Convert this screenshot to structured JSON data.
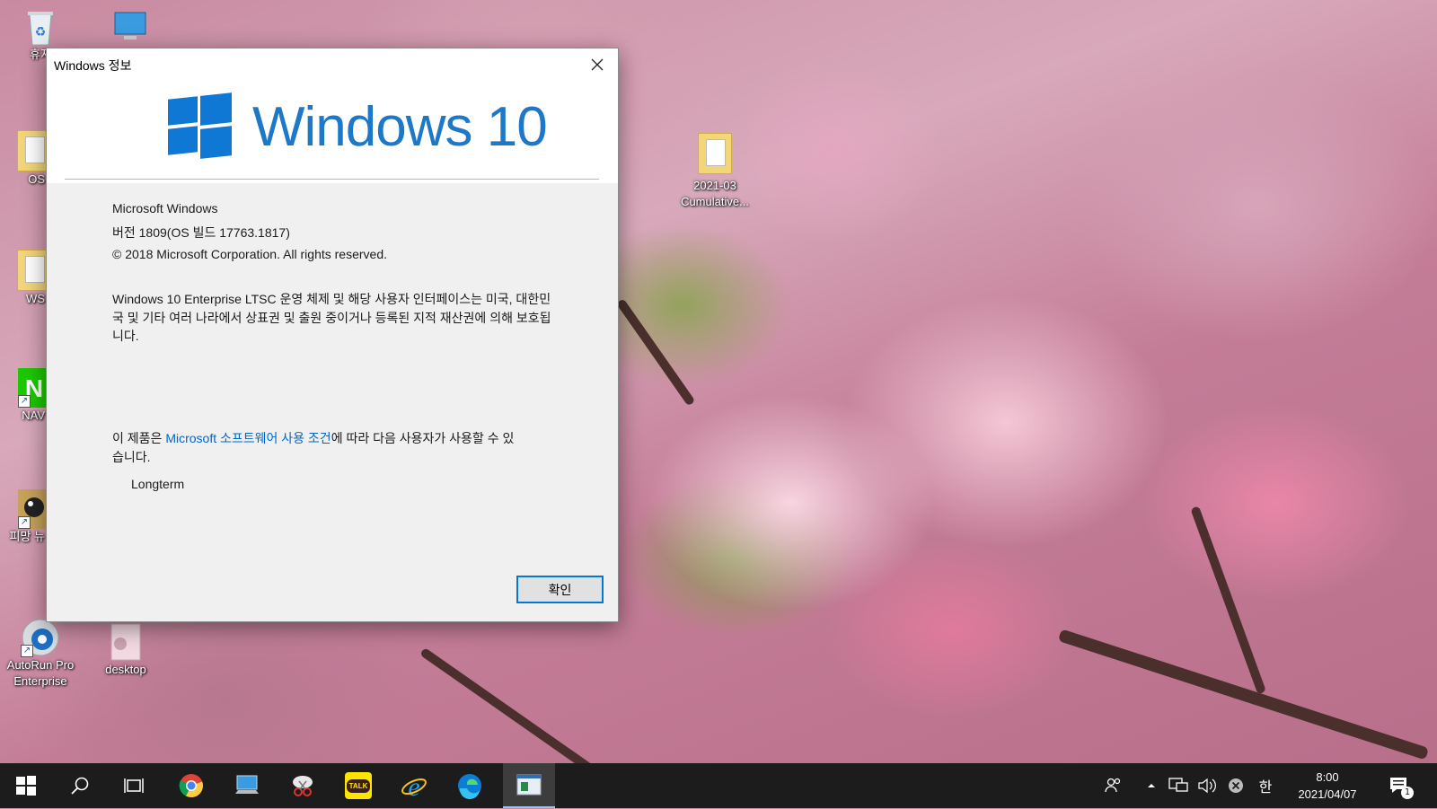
{
  "dialog": {
    "title": "Windows 정보",
    "wordmark": "Windows 10",
    "product": "Microsoft Windows",
    "version": "버전 1809(OS 빌드 17763.1817)",
    "copyright": "© 2018 Microsoft Corporation. All rights reserved.",
    "legal_text": "Windows 10 Enterprise LTSC 운영 체제 및 해당 사용자 인터페이스는 미국, 대한민국 및 기타 여러 나라에서 상표권 및 출원 중이거나 등록된 지적 재산권에 의해 보호됩니다.",
    "license_prefix": "이 제품은 ",
    "license_link": "Microsoft 소프트웨어 사용 조건",
    "license_suffix": "에 따라 다음 사용자가 사용할 수 있습니다.",
    "licensed_user": "Longterm",
    "ok_label": "확인"
  },
  "desktop_icons": [
    {
      "label": "휴지",
      "icon": "recycle-bin-icon"
    },
    {
      "label": "OS",
      "icon": "folder-icon"
    },
    {
      "label": "WS",
      "icon": "document-icon"
    },
    {
      "label": "NAV",
      "icon": "naver-icon"
    },
    {
      "label": "피망 뉴",
      "icon": "game-icon"
    },
    {
      "label": "AutoRun Pro Enterprise",
      "icon": "autorun-icon"
    },
    {
      "label": "desktop",
      "icon": "desktop-file-icon"
    },
    {
      "label": "2021-03 Cumulative...",
      "icon": "folder-icon"
    }
  ],
  "taskbar": {
    "apps": [
      "start-icon",
      "search-icon",
      "task-view-icon",
      "chrome-icon",
      "this-pc-icon",
      "snipping-tool-icon",
      "kakaotalk-icon",
      "internet-explorer-icon",
      "edge-icon",
      "winver-icon"
    ],
    "kakao_label": "TALK",
    "ime": "한",
    "time": "8:00",
    "date": "2021/04/07",
    "notification_count": "1"
  }
}
